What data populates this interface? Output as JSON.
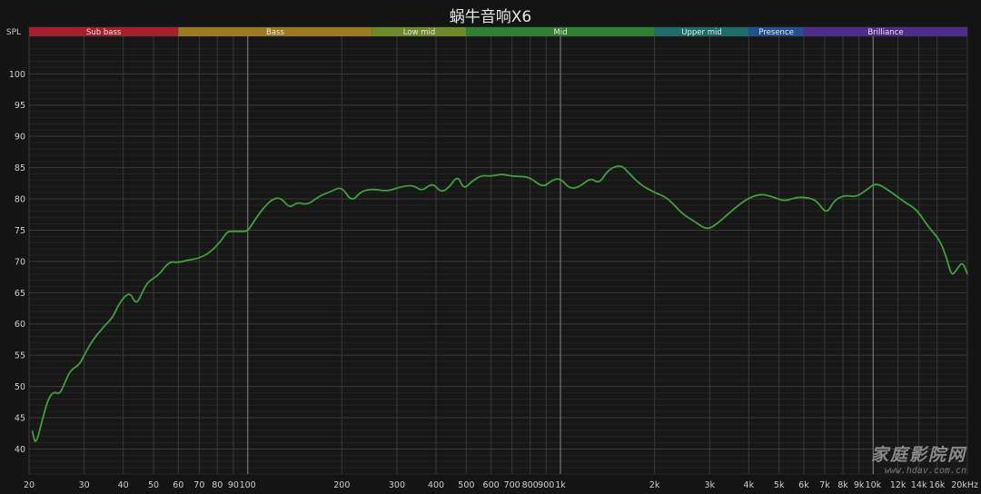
{
  "title": "蜗牛音响X6",
  "watermark": {
    "main": "家庭影院网",
    "sub": "www.hdav.com.cn"
  },
  "colors": {
    "background": "#141414",
    "plot_background": "#171717",
    "grid": "#3a3a3a",
    "curve": "#3fa03a"
  },
  "chart_data": {
    "type": "line",
    "title": "蜗牛音响X6",
    "ylabel": "SPL",
    "xlabel": "",
    "x_scale": "log",
    "xlim": [
      20,
      20000
    ],
    "ylim": [
      36,
      106
    ],
    "grid": true,
    "x_ticks": [
      {
        "value": 20,
        "label": "20"
      },
      {
        "value": 30,
        "label": "30"
      },
      {
        "value": 40,
        "label": "40"
      },
      {
        "value": 50,
        "label": "50"
      },
      {
        "value": 60,
        "label": "60"
      },
      {
        "value": 70,
        "label": "70"
      },
      {
        "value": 80,
        "label": "80"
      },
      {
        "value": 90,
        "label": "90"
      },
      {
        "value": 100,
        "label": "100"
      },
      {
        "value": 200,
        "label": "200"
      },
      {
        "value": 300,
        "label": "300"
      },
      {
        "value": 400,
        "label": "400"
      },
      {
        "value": 500,
        "label": "500"
      },
      {
        "value": 600,
        "label": "600"
      },
      {
        "value": 700,
        "label": "700"
      },
      {
        "value": 800,
        "label": "800"
      },
      {
        "value": 900,
        "label": "900"
      },
      {
        "value": 1000,
        "label": "1k"
      },
      {
        "value": 2000,
        "label": "2k"
      },
      {
        "value": 3000,
        "label": "3k"
      },
      {
        "value": 4000,
        "label": "4k"
      },
      {
        "value": 5000,
        "label": "5k"
      },
      {
        "value": 6000,
        "label": "6k"
      },
      {
        "value": 7000,
        "label": "7k"
      },
      {
        "value": 8000,
        "label": "8k"
      },
      {
        "value": 9000,
        "label": "9k"
      },
      {
        "value": 10000,
        "label": "10k"
      },
      {
        "value": 12000,
        "label": "12k"
      },
      {
        "value": 14000,
        "label": "14k"
      },
      {
        "value": 16000,
        "label": "16k"
      },
      {
        "value": 20000,
        "label": "20kHz"
      }
    ],
    "y_ticks": [
      40,
      45,
      50,
      55,
      60,
      65,
      70,
      75,
      80,
      85,
      90,
      95,
      100
    ],
    "bands": [
      {
        "label": "Sub bass",
        "from": 20,
        "to": 60,
        "color": "#a3202c"
      },
      {
        "label": "Bass",
        "from": 60,
        "to": 250,
        "color": "#9a7a22"
      },
      {
        "label": "Low mid",
        "from": 250,
        "to": 500,
        "color": "#6f8a2a"
      },
      {
        "label": "Mid",
        "from": 500,
        "to": 2000,
        "color": "#2f7f34"
      },
      {
        "label": "Upper mid",
        "from": 2000,
        "to": 4000,
        "color": "#1f6a6a"
      },
      {
        "label": "Presence",
        "from": 4000,
        "to": 6000,
        "color": "#24508e"
      },
      {
        "label": "Brilliance",
        "from": 6000,
        "to": 20000,
        "color": "#4f2c8a"
      }
    ],
    "series": [
      {
        "points": [
          [
            20.5,
            42.8
          ],
          [
            21,
            40.5
          ],
          [
            22,
            44.5
          ],
          [
            23,
            48.0
          ],
          [
            24,
            49.2
          ],
          [
            25,
            48.7
          ],
          [
            26,
            50.5
          ],
          [
            27,
            52.5
          ],
          [
            29,
            53.5
          ],
          [
            30,
            55.0
          ],
          [
            32,
            57.5
          ],
          [
            35,
            59.8
          ],
          [
            37,
            61.0
          ],
          [
            39,
            63.5
          ],
          [
            42,
            65.2
          ],
          [
            44,
            63.0
          ],
          [
            46,
            65.0
          ],
          [
            48,
            66.8
          ],
          [
            52,
            67.8
          ],
          [
            56,
            70.0
          ],
          [
            60,
            69.8
          ],
          [
            64,
            70.2
          ],
          [
            70,
            70.5
          ],
          [
            76,
            71.5
          ],
          [
            82,
            73.2
          ],
          [
            86,
            74.8
          ],
          [
            90,
            74.8
          ],
          [
            95,
            74.8
          ],
          [
            100,
            74.8
          ],
          [
            105,
            76.5
          ],
          [
            112,
            78.5
          ],
          [
            120,
            80.0
          ],
          [
            128,
            80.2
          ],
          [
            136,
            78.5
          ],
          [
            144,
            79.5
          ],
          [
            155,
            79.0
          ],
          [
            170,
            80.5
          ],
          [
            185,
            81.2
          ],
          [
            200,
            82.0
          ],
          [
            215,
            79.5
          ],
          [
            230,
            81.2
          ],
          [
            250,
            81.6
          ],
          [
            280,
            81.2
          ],
          [
            310,
            82.0
          ],
          [
            340,
            82.2
          ],
          [
            360,
            81.2
          ],
          [
            390,
            82.6
          ],
          [
            415,
            81.0
          ],
          [
            440,
            81.8
          ],
          [
            470,
            83.8
          ],
          [
            490,
            81.5
          ],
          [
            520,
            82.8
          ],
          [
            560,
            83.8
          ],
          [
            600,
            83.6
          ],
          [
            650,
            84.0
          ],
          [
            700,
            83.6
          ],
          [
            750,
            83.6
          ],
          [
            800,
            83.4
          ],
          [
            880,
            81.8
          ],
          [
            940,
            83.0
          ],
          [
            1000,
            83.3
          ],
          [
            1070,
            81.6
          ],
          [
            1150,
            81.9
          ],
          [
            1250,
            83.4
          ],
          [
            1330,
            82.4
          ],
          [
            1420,
            84.7
          ],
          [
            1560,
            85.5
          ],
          [
            1650,
            84.2
          ],
          [
            1800,
            82.3
          ],
          [
            2000,
            81.0
          ],
          [
            2200,
            80.2
          ],
          [
            2450,
            77.6
          ],
          [
            2700,
            76.3
          ],
          [
            2950,
            75.0
          ],
          [
            3200,
            76.2
          ],
          [
            3600,
            78.5
          ],
          [
            4000,
            80.2
          ],
          [
            4400,
            80.8
          ],
          [
            4800,
            80.3
          ],
          [
            5200,
            79.6
          ],
          [
            5700,
            80.3
          ],
          [
            6200,
            80.2
          ],
          [
            6600,
            79.7
          ],
          [
            7100,
            77.5
          ],
          [
            7500,
            79.8
          ],
          [
            8100,
            80.6
          ],
          [
            8800,
            80.3
          ],
          [
            9500,
            81.4
          ],
          [
            10200,
            82.6
          ],
          [
            11200,
            81.4
          ],
          [
            12500,
            79.6
          ],
          [
            13800,
            78.3
          ],
          [
            15000,
            75.5
          ],
          [
            16300,
            73.5
          ],
          [
            17200,
            70.5
          ],
          [
            17800,
            67.6
          ],
          [
            18500,
            68.7
          ],
          [
            19300,
            70.0
          ],
          [
            20000,
            68.0
          ]
        ]
      }
    ]
  }
}
